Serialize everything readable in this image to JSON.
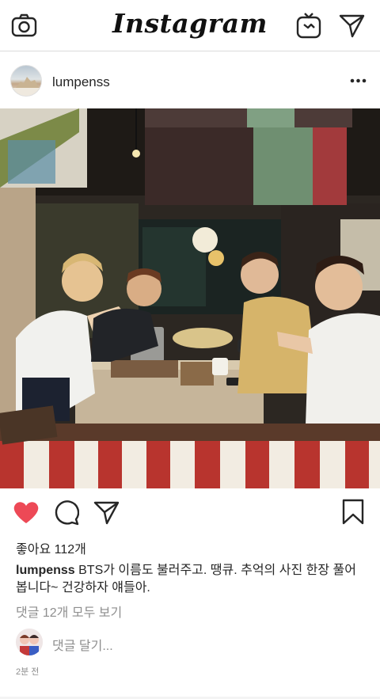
{
  "topbar": {
    "title": "Instagram",
    "left_icon": "camera-icon",
    "right_icons": [
      "igtv-icon",
      "direct-message-icon"
    ]
  },
  "post": {
    "username": "lumpenss",
    "more_icon": "more-options-icon",
    "photo_alt": "",
    "actions": {
      "like_icon": "heart-filled-icon",
      "like_color": "#ed4956",
      "comment_icon": "comment-icon",
      "share_icon": "share-icon",
      "save_icon": "bookmark-icon"
    },
    "likes_text": "좋아요 112개",
    "caption": {
      "username": "lumpenss",
      "text": " BTS가 이름도 불러주고. 땡큐.  추억의 사진 한장 풀어 봅니다~ 건강하자 얘들아."
    },
    "view_comments": "댓글 12개 모두 보기",
    "comment_placeholder": "댓글 달기...",
    "timestamp": "2분 전"
  }
}
